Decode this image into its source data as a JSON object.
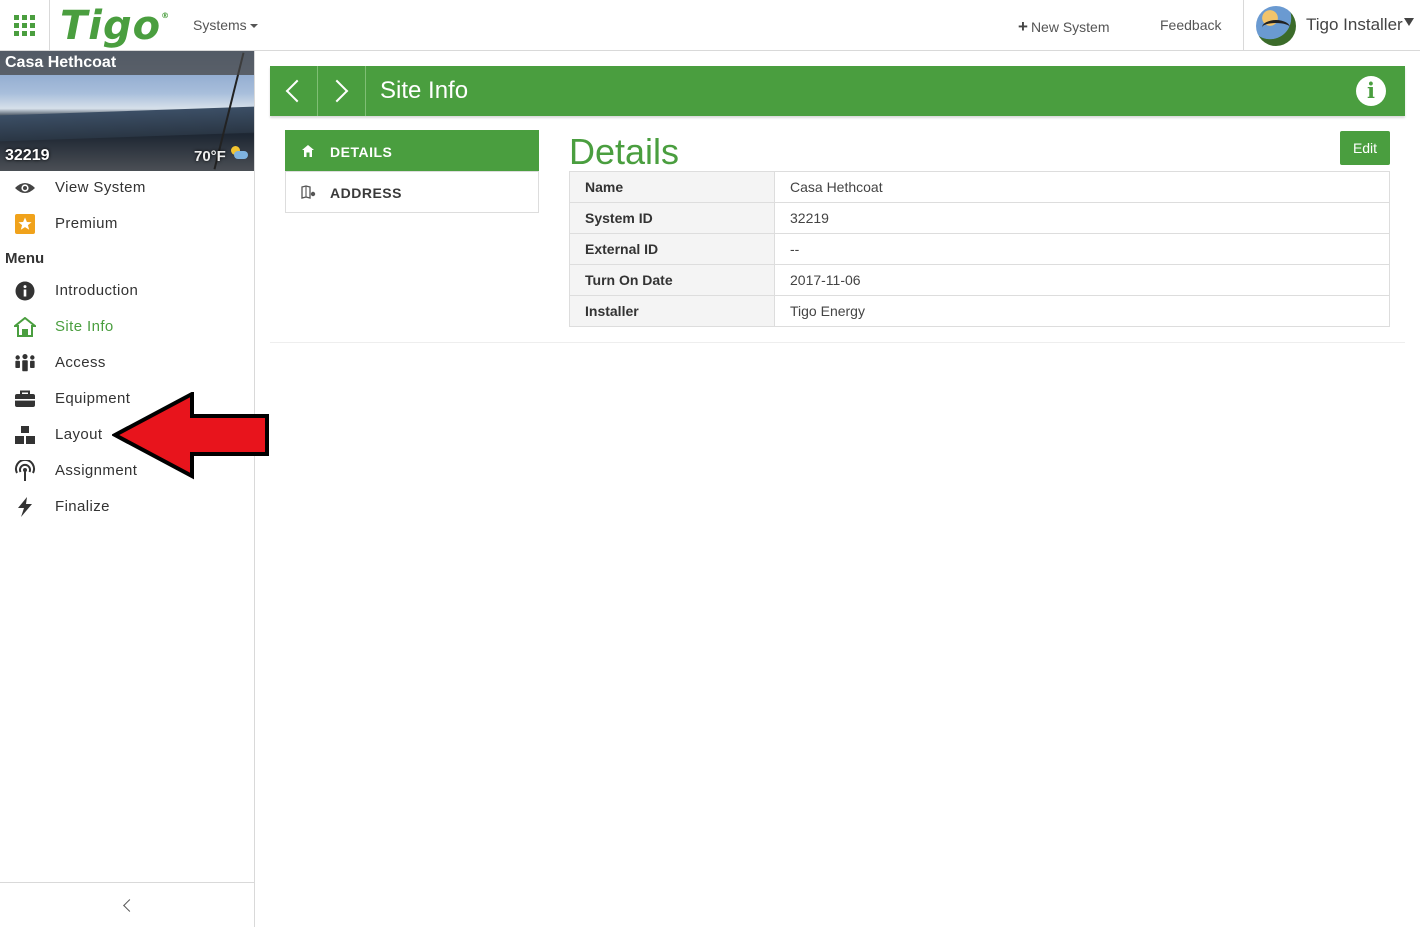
{
  "topbar": {
    "brand": "Tigo",
    "systems_label": "Systems",
    "new_system_label": "New System",
    "feedback_label": "Feedback",
    "username": "Tigo Installer"
  },
  "site": {
    "name": "Casa Hethcoat",
    "id": "32219",
    "temperature": "70°F"
  },
  "sidebar": {
    "top_items": [
      {
        "label": "View System",
        "icon": "eye-icon"
      },
      {
        "label": "Premium",
        "icon": "star-icon"
      }
    ],
    "menu_heading": "Menu",
    "menu_items": [
      {
        "label": "Introduction",
        "icon": "info-icon"
      },
      {
        "label": "Site Info",
        "icon": "home-icon",
        "active": true
      },
      {
        "label": "Access",
        "icon": "people-icon"
      },
      {
        "label": "Equipment",
        "icon": "toolbox-icon"
      },
      {
        "label": "Layout",
        "icon": "blocks-icon"
      },
      {
        "label": "Assignment",
        "icon": "antenna-icon"
      },
      {
        "label": "Finalize",
        "icon": "bolt-icon"
      }
    ]
  },
  "header": {
    "title": "Site Info"
  },
  "subnav": {
    "items": [
      {
        "label": "DETAILS",
        "active": true
      },
      {
        "label": "ADDRESS",
        "active": false
      }
    ]
  },
  "details": {
    "title": "Details",
    "edit_label": "Edit",
    "rows": [
      {
        "key": "Name",
        "value": "Casa Hethcoat"
      },
      {
        "key": "System ID",
        "value": "32219"
      },
      {
        "key": "External ID",
        "value": "--"
      },
      {
        "key": "Turn On Date",
        "value": "2017-11-06"
      },
      {
        "key": "Installer",
        "value": "Tigo Energy"
      }
    ]
  },
  "colors": {
    "brand_green": "#4a9e3f",
    "annotation_red": "#e8141c"
  }
}
